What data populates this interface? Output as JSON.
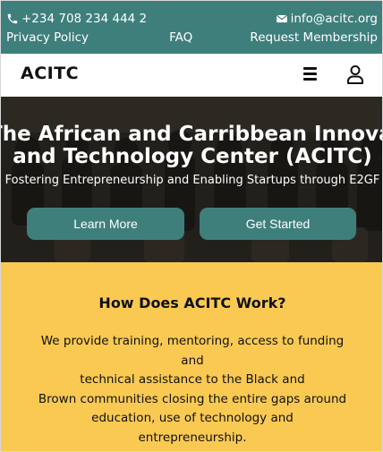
{
  "topbar": {
    "phone": "+234 708 234 444 2",
    "email": "info@acitc.org",
    "links": [
      "Privacy Policy",
      "FAQ",
      "Request Membership"
    ],
    "color": "#3e7f7c"
  },
  "header": {
    "logo": "ACITC",
    "icons": [
      "menu-icon",
      "user-icon"
    ]
  },
  "hero": {
    "title_line1": "The African and Carribbean Innovation",
    "title_line2": "and Technology Center (ACITC)",
    "subtitle": "Fostering Entrepreneurship and Enabling Startups through E2GF",
    "learn_more": "Learn More",
    "get_started": "Get Started",
    "button_color": "#3e7f7c"
  },
  "how": {
    "heading": "How Does ACITC Work?",
    "body_lines": [
      "We provide training, mentoring, access to funding and",
      "technical assistance to the Black and",
      "Brown communities closing the entire gaps around",
      "education, use of technology and",
      "entrepreneurship."
    ],
    "background": "#f9c952"
  }
}
